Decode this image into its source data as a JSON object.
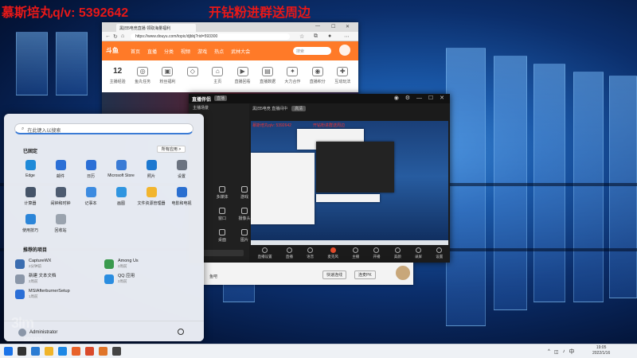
{
  "overlay": {
    "left_text": "慕斯培丸q/v: 5392642",
    "right_text": "开钻粉进群送周边"
  },
  "browser": {
    "tab_title": "黑旧5电竞直播 领取海量福利",
    "url": "https://www.douyu.com/topic/djbbj?rid=593300",
    "site_logo": "斗鱼",
    "nav": [
      "首页",
      "直播",
      "分类",
      "视频",
      "游戏",
      "热点",
      "武林大会"
    ],
    "search_placeholder": "搜索",
    "icons": [
      {
        "label": "主播经验",
        "value": "12"
      },
      {
        "label": "鱼丸任务",
        "value": ""
      },
      {
        "label": "粉丝福利",
        "value": ""
      },
      {
        "label": "",
        "value": ""
      },
      {
        "label": "主页",
        "value": ""
      },
      {
        "label": "直播回看",
        "value": ""
      },
      {
        "label": "直播数据",
        "value": ""
      },
      {
        "label": "大力合作",
        "value": ""
      },
      {
        "label": "直播积分",
        "value": ""
      },
      {
        "label": "互动玩法",
        "value": ""
      }
    ]
  },
  "obs": {
    "logo": "直播伴侣",
    "live_badge": "直播",
    "scene_label": "主播场景",
    "info_title": "黑旧5电竞 直播间中",
    "info_sel": "高清",
    "preview_red_left": "慕斯培丸q/v: 5392642",
    "preview_red_right": "开钻粉进群送周边",
    "tools": [
      "多媒体",
      "游戏",
      "窗口",
      "摄像头",
      "桌面",
      "图片"
    ],
    "bottom_buttons": [
      "直播设置",
      "直播",
      "语音",
      "麦克风",
      "主播",
      "开播",
      "美颜",
      "录屏",
      "设置"
    ]
  },
  "strip": {
    "left": "鱼吧",
    "btn1": "快速连线",
    "btn2": "连麦PK"
  },
  "start_menu": {
    "search_placeholder": "在此键入以搜索",
    "pinned_label": "已固定",
    "all_apps_label": "所有应用 >",
    "pinned": [
      {
        "label": "Edge",
        "color": "#1f8ad8"
      },
      {
        "label": "邮件",
        "color": "#2b6fd6"
      },
      {
        "label": "日历",
        "color": "#2b6fd6"
      },
      {
        "label": "Microsoft Store",
        "color": "#3a7bd5"
      },
      {
        "label": "照片",
        "color": "#1c78d0"
      },
      {
        "label": "设置",
        "color": "#6b7380"
      },
      {
        "label": "计算器",
        "color": "#455468"
      },
      {
        "label": "闹钟和时钟",
        "color": "#4d5b70"
      },
      {
        "label": "记事本",
        "color": "#3c8be0"
      },
      {
        "label": "画图",
        "color": "#2f95e0"
      },
      {
        "label": "文件资源管理器",
        "color": "#f2b52e"
      },
      {
        "label": "电影和电视",
        "color": "#2a6fd0"
      },
      {
        "label": "使用技巧",
        "color": "#2b85d8"
      },
      {
        "label": "回收站",
        "color": "#9aa3ae"
      }
    ],
    "recommended_label": "推荐的项目",
    "recommended": [
      {
        "title": "CaptureWX",
        "sub": "2分钟前",
        "color": "#3b6db0"
      },
      {
        "title": "Among Us",
        "sub": "2周前",
        "color": "#3a9a4e"
      },
      {
        "title": "新建 文本文档",
        "sub": "2周前",
        "color": "#8a96a8"
      },
      {
        "title": "QQ 应用",
        "sub": "2周前",
        "color": "#2a8de0"
      },
      {
        "title": "MSIAfterburnerSetup",
        "sub": "1周前",
        "color": "#2b6fd6"
      }
    ],
    "user_name": "Administrator"
  },
  "watermark": {
    "mark": "3lm",
    "room": "593300"
  },
  "taskbar": {
    "icon_colors": [
      "#1a73e8",
      "#333333",
      "#2b7cd3",
      "#f0b429",
      "#1e88e5",
      "#e8622a",
      "#d94a2b",
      "#e0752a",
      "#444444"
    ],
    "tray_text": "^",
    "ime": "中",
    "time": "19:05",
    "date": "2022/1/16"
  }
}
